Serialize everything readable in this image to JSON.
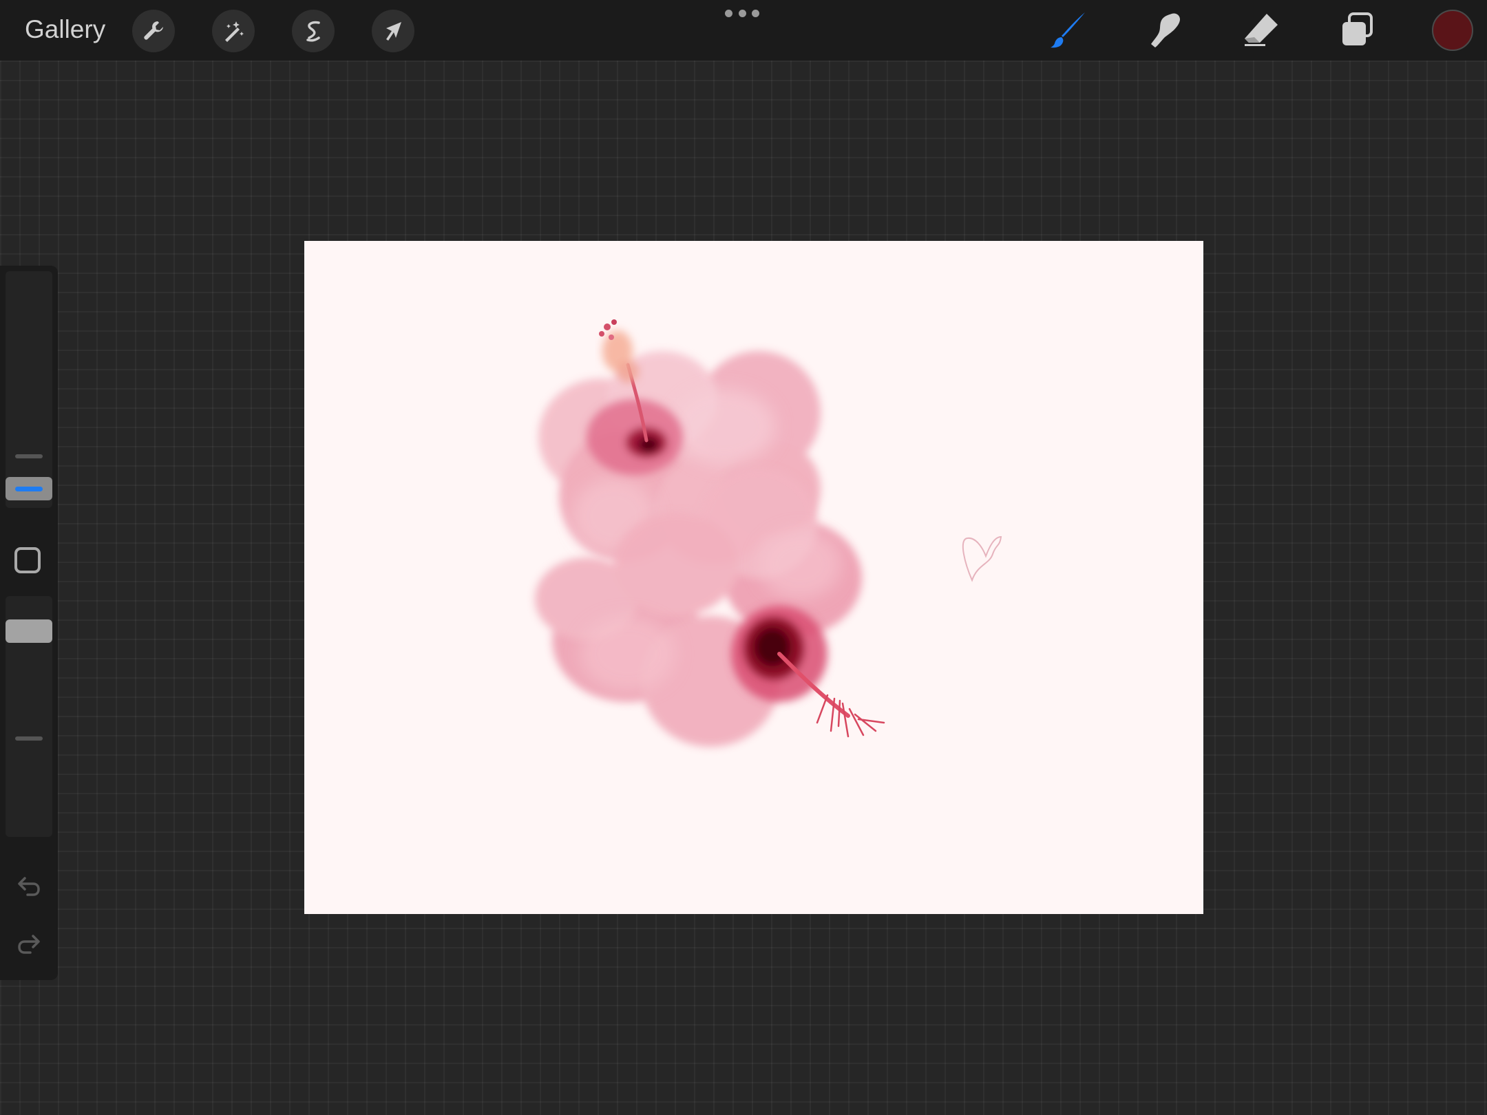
{
  "topbar": {
    "gallery_label": "Gallery",
    "left_tools": [
      {
        "name": "actions",
        "icon": "wrench-icon"
      },
      {
        "name": "adjustments",
        "icon": "magic-wand-icon"
      },
      {
        "name": "selection",
        "icon": "selection-s-icon"
      },
      {
        "name": "transform",
        "icon": "arrow-cursor-icon"
      }
    ],
    "more_menu_icon": "ellipsis-icon",
    "right_tools": [
      {
        "name": "brush",
        "icon": "brush-icon",
        "active": true
      },
      {
        "name": "smudge",
        "icon": "smudge-finger-icon",
        "active": false
      },
      {
        "name": "eraser",
        "icon": "eraser-icon",
        "active": false
      },
      {
        "name": "layers",
        "icon": "layers-icon",
        "active": false
      }
    ],
    "current_color": "#5a1418",
    "active_tool_color": "#1e7cf2"
  },
  "sidebar": {
    "size_slider_icon": "size-slider-handle",
    "modify_button_icon": "square-outline-icon",
    "opacity_slider_icon": "opacity-slider-handle",
    "undo_icon": "undo-arrow-icon",
    "redo_icon": "redo-arrow-icon"
  },
  "canvas": {
    "background_color": "#fff6f6",
    "artwork": "pink-hibiscus-flowers-with-heart-doodle"
  }
}
